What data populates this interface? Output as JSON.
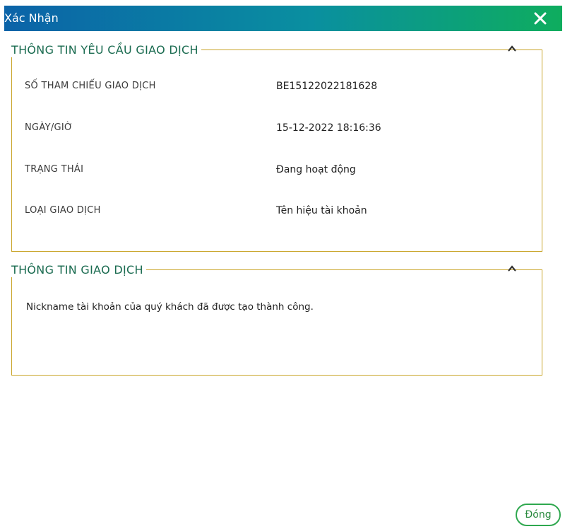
{
  "dialog": {
    "title": "Xác Nhận",
    "close_icon": "close-icon",
    "accent_color": "#c9a52a",
    "header_gradient": [
      "#0b63a8",
      "#0ead5e"
    ]
  },
  "request_section": {
    "title": "THÔNG TIN YÊU CẦU GIAO DỊCH",
    "collapse_icon": "chevron-up-icon",
    "rows": [
      {
        "label": "SỐ THAM CHIẾU GIAO DỊCH",
        "value": "BE15122022181628"
      },
      {
        "label": "NGÀY/GIỜ",
        "value": "15-12-2022 18:16:36"
      },
      {
        "label": "TRẠNG THÁI",
        "value": "Đang hoạt động"
      },
      {
        "label": "LOẠI GIAO DỊCH",
        "value": "Tên hiệu tài khoản"
      }
    ]
  },
  "transaction_section": {
    "title": "THÔNG TIN GIAO DỊCH",
    "collapse_icon": "chevron-up-icon",
    "message": "Nickname tài khoản của quý khách đã được tạo thành công."
  },
  "footer": {
    "close_label": "Đóng",
    "button_color": "#2fa84f"
  }
}
